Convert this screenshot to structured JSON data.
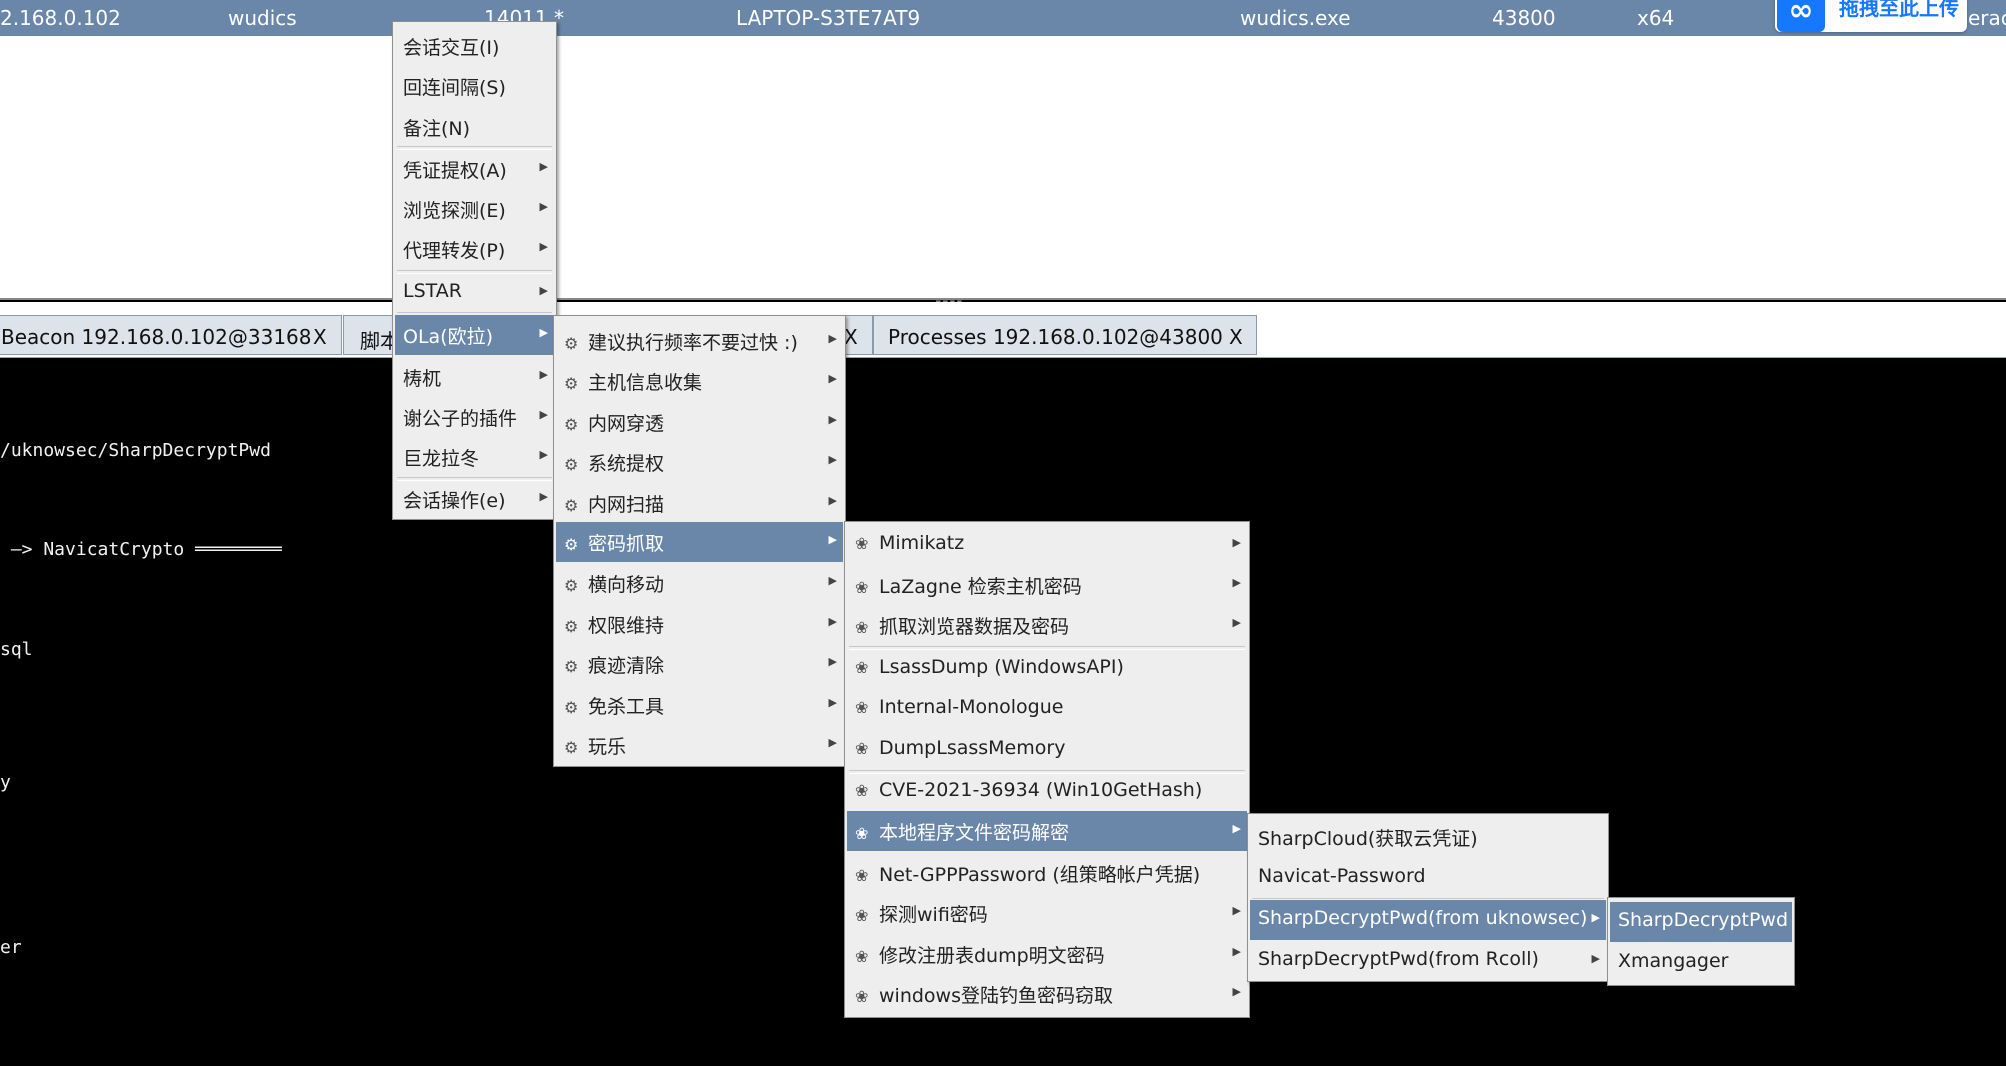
{
  "session_row": {
    "ip": "2.168.0.102",
    "user": "wudics",
    "pid_partial": "14011 *",
    "computer": "LAPTOP-S3TE7AT9",
    "process": "wudics.exe",
    "pid": "43800",
    "arch": "x64",
    "trailing": "erac"
  },
  "upload_badge": {
    "text": "拖拽至此上传",
    "icon": "cloud-infinity-icon"
  },
  "tabs": [
    {
      "label": "Beacon 192.168.0.102@33168",
      "close": "X"
    },
    {
      "label": "脚本",
      "close": "X"
    },
    {
      "label": "Processes 192.168.0.102@43800",
      "close": "X"
    }
  ],
  "console_lines": [
    "/uknowsec/SharpDecryptPwd",
    " —> NavicatCrypto ════════",
    "sql",
    "y",
    "er"
  ],
  "menu_main": [
    {
      "label": "会话交互(I)"
    },
    {
      "label": "回连间隔(S)"
    },
    {
      "label": "备注(N)"
    },
    {
      "label": "凭证提权(A)"
    },
    {
      "label": "浏览探测(E)"
    },
    {
      "label": "代理转发(P)"
    },
    {
      "label": "LSTAR"
    },
    {
      "label": "OLa(欧拉)"
    },
    {
      "label": "梼杌"
    },
    {
      "label": "谢公子的插件"
    },
    {
      "label": "巨龙拉冬"
    },
    {
      "label": "会话操作(e)"
    }
  ],
  "menu_ola": [
    {
      "label": "建议执行频率不要过快 :)"
    },
    {
      "label": "主机信息收集"
    },
    {
      "label": "内网穿透"
    },
    {
      "label": "系统提权"
    },
    {
      "label": "内网扫描"
    },
    {
      "label": "密码抓取"
    },
    {
      "label": "横向移动"
    },
    {
      "label": "权限维持"
    },
    {
      "label": "痕迹清除"
    },
    {
      "label": "免杀工具"
    },
    {
      "label": "玩乐"
    }
  ],
  "menu_password": [
    {
      "label": "Mimikatz"
    },
    {
      "label": "LaZagne 检索主机密码"
    },
    {
      "label": "抓取浏览器数据及密码"
    },
    {
      "label": "LsassDump (WindowsAPI)"
    },
    {
      "label": "Internal-Monologue"
    },
    {
      "label": "DumpLsassMemory"
    },
    {
      "label": "CVE-2021-36934 (Win10GetHash)"
    },
    {
      "label": "本地程序文件密码解密"
    },
    {
      "label": "Net-GPPPassword (组策略帐户凭据)"
    },
    {
      "label": "探测wifi密码"
    },
    {
      "label": "修改注册表dump明文密码"
    },
    {
      "label": "windows登陆钓鱼密码窃取"
    }
  ],
  "menu_local_decrypt": [
    {
      "label": "SharpCloud(获取云凭证)"
    },
    {
      "label": "Navicat-Password"
    },
    {
      "label": "SharpDecryptPwd(from uknowsec)"
    },
    {
      "label": "SharpDecryptPwd(from Rcoll)"
    }
  ],
  "menu_sharpdecrypt": [
    {
      "label": "SharpDecryptPwd"
    },
    {
      "label": "Xmangager"
    }
  ],
  "icons": {
    "ola_item": "gear-cluster-icon",
    "password_item": "flower-icon",
    "submenu_arrow": "submenu-arrow-icon"
  },
  "colors": {
    "highlight": "#6a86a8",
    "menu_bg": "#eeeeee",
    "console_bg": "#000000"
  }
}
